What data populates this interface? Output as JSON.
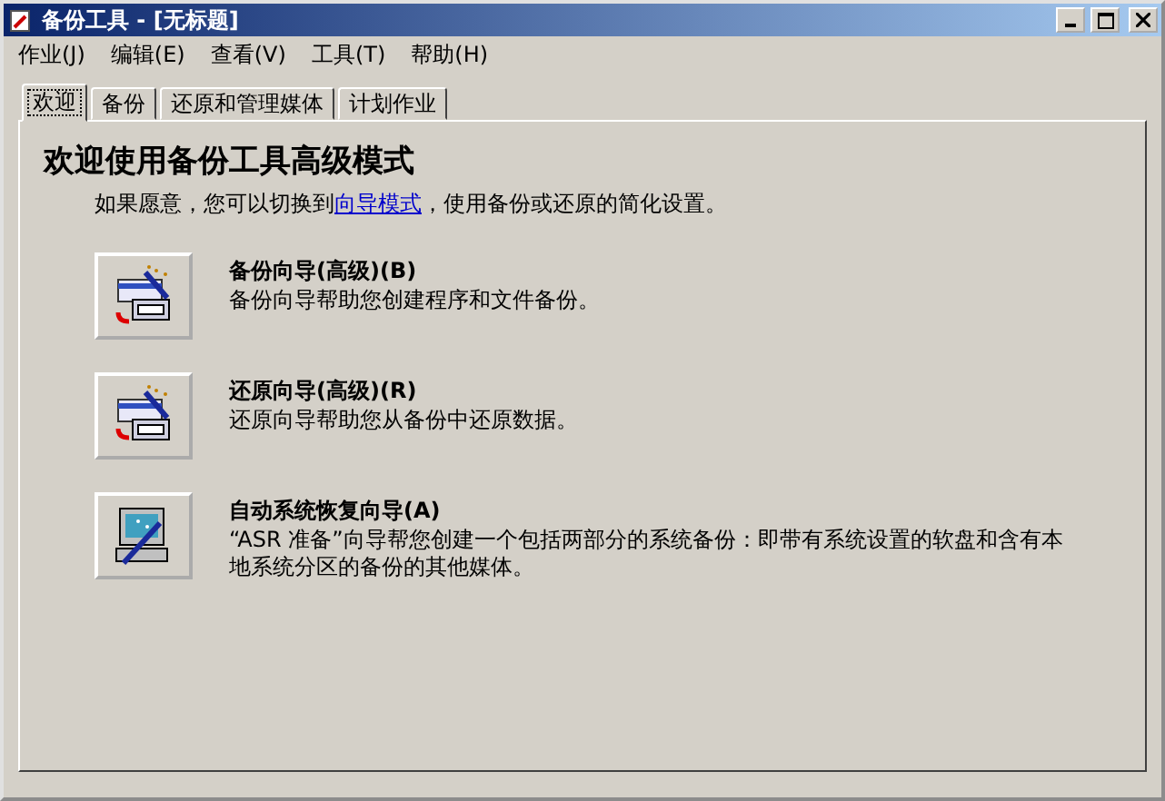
{
  "window": {
    "title": "备份工具 - [无标题]"
  },
  "menu": [
    "作业(J)",
    "编辑(E)",
    "查看(V)",
    "工具(T)",
    "帮助(H)"
  ],
  "tabs": [
    {
      "label": "欢迎",
      "selected": true
    },
    {
      "label": "备份",
      "selected": false
    },
    {
      "label": "还原和管理媒体",
      "selected": false
    },
    {
      "label": "计划作业",
      "selected": false
    }
  ],
  "welcome": {
    "heading": "欢迎使用备份工具高级模式",
    "intro_before": "如果愿意，您可以切换到",
    "intro_link": "向导模式",
    "intro_after": "，使用备份或还原的简化设置。"
  },
  "wizards": [
    {
      "kind": "backup",
      "title": "备份向导(高级)(B)",
      "description": "备份向导帮助您创建程序和文件备份。"
    },
    {
      "kind": "restore",
      "title": "还原向导(高级)(R)",
      "description": "还原向导帮助您从备份中还原数据。"
    },
    {
      "kind": "asr",
      "title": "自动系统恢复向导(A)",
      "description": "“ASR 准备”向导帮您创建一个包括两部分的系统备份：即带有系统设置的软盘和含有本地系统分区的备份的其他媒体。"
    }
  ]
}
